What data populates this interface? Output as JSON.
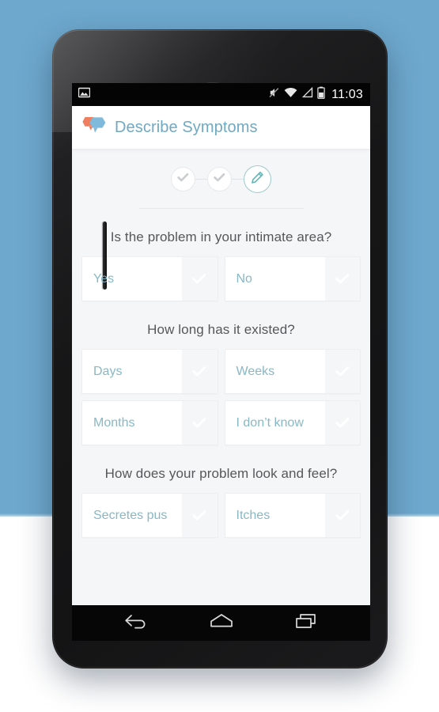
{
  "backdrop": {
    "blue": "#6ea8cd",
    "white": "#ffffff"
  },
  "device": {
    "name": "android-phone",
    "body_color": "#191a1b"
  },
  "status_bar": {
    "clock": "11:03",
    "icons": {
      "notification": "image-icon",
      "silent": "mute-icon",
      "wifi": "wifi-icon",
      "signal": "cell-signal-icon",
      "battery": "battery-icon"
    }
  },
  "app_bar": {
    "title": "Describe Symptoms",
    "title_color": "#6fa9c4",
    "logo": "speech-bubbles-logo",
    "logo_colors": {
      "back": "#ef7f5e",
      "front": "#7fb9db"
    }
  },
  "stepper": {
    "accent_color": "#5fb6b6",
    "steps": [
      {
        "name": "step-1",
        "state": "completed",
        "icon": "check-icon"
      },
      {
        "name": "step-2",
        "state": "completed",
        "icon": "check-icon"
      },
      {
        "name": "step-3",
        "state": "active",
        "icon": "pencil-icon"
      }
    ]
  },
  "questions": [
    {
      "title": "Is the problem in your intimate area?",
      "options": [
        {
          "label": "Yes",
          "selected": false
        },
        {
          "label": "No",
          "selected": false
        }
      ]
    },
    {
      "title": "How long has it existed?",
      "options": [
        {
          "label": "Days",
          "selected": false
        },
        {
          "label": "Weeks",
          "selected": false
        },
        {
          "label": "Months",
          "selected": false
        },
        {
          "label": "I don’t know",
          "selected": false
        }
      ]
    },
    {
      "title": "How does your problem look and feel?",
      "options": [
        {
          "label": "Secretes pus",
          "selected": false
        },
        {
          "label": "Itches",
          "selected": false
        }
      ]
    }
  ],
  "nav_bar": {
    "buttons": [
      {
        "name": "back-button",
        "icon": "back-arrow-icon"
      },
      {
        "name": "home-button",
        "icon": "home-icon"
      },
      {
        "name": "recents-button",
        "icon": "recent-apps-icon"
      }
    ]
  },
  "colors": {
    "option_text": "#88b8c4",
    "question_text": "#555759",
    "screen_background": "#f5f6f8"
  }
}
